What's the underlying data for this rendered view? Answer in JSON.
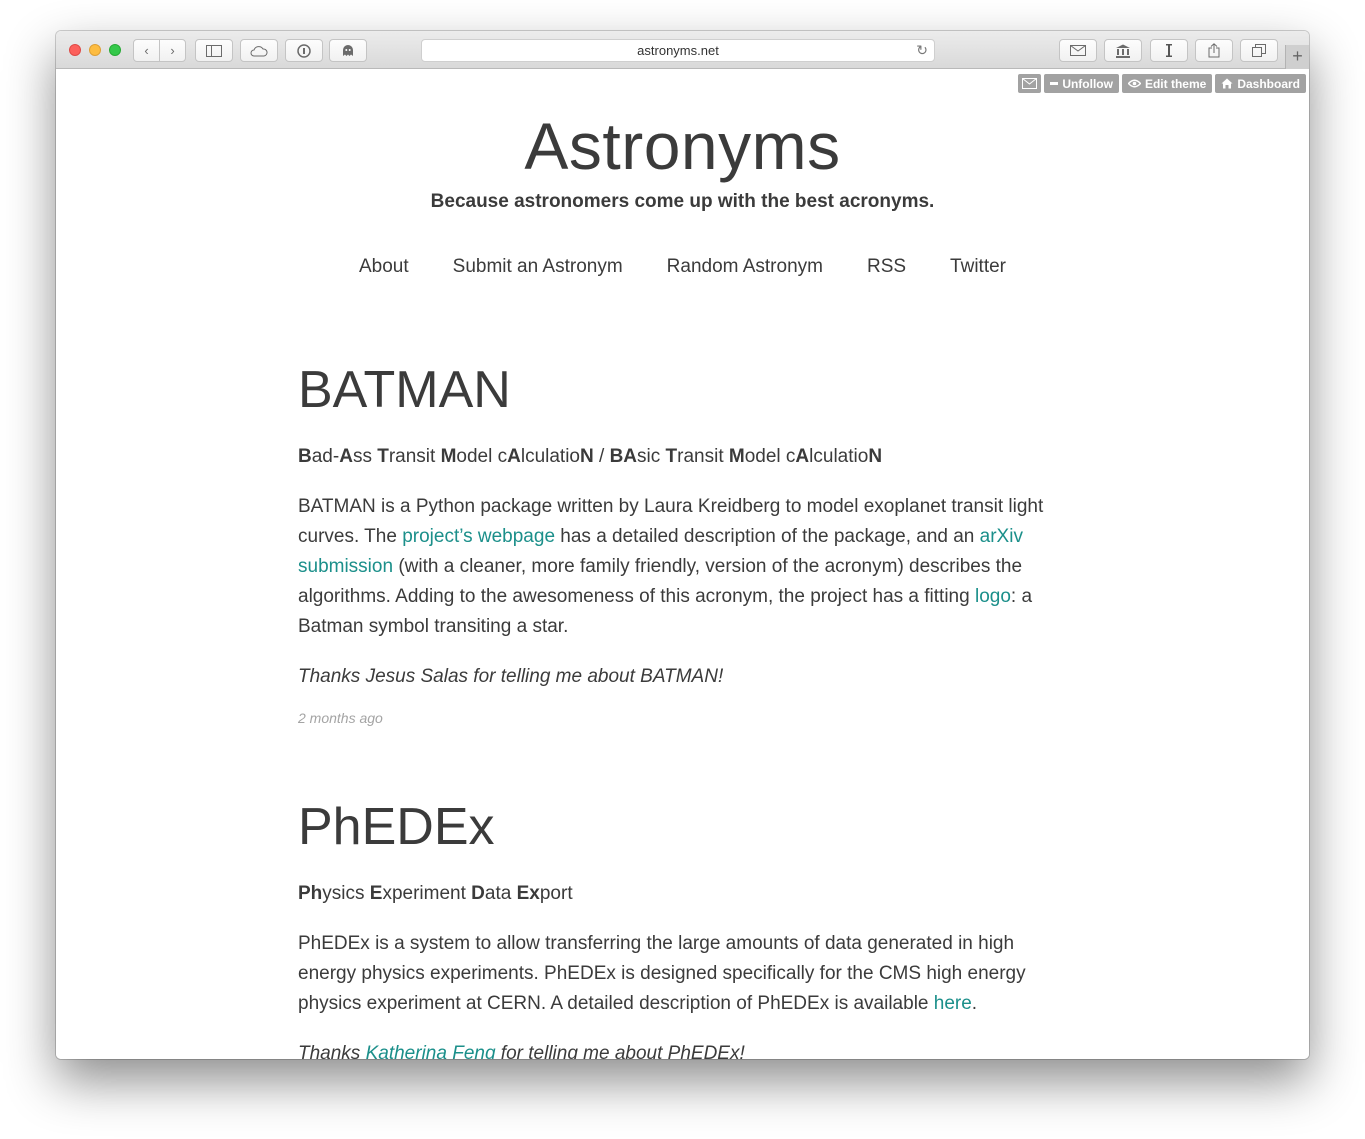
{
  "browser": {
    "url": "astronyms.net",
    "nav_back": "‹",
    "nav_forward": "›",
    "new_tab": "+",
    "reload": "↻"
  },
  "tumblr": {
    "unfollow": "Unfollow",
    "edit_theme": "Edit theme",
    "dashboard": "Dashboard"
  },
  "site": {
    "title": "Astronyms",
    "description": "Because astronomers come up with the best acronyms.",
    "nav": [
      "About",
      "Submit an Astronym",
      "Random Astronym",
      "RSS",
      "Twitter"
    ]
  },
  "posts": [
    {
      "title": "BATMAN",
      "expansion_1": {
        "b1": "B",
        "t1": "ad-",
        "b2": "A",
        "t2": "ss ",
        "b3": "T",
        "t3": "ransit ",
        "b4": "M",
        "t4": "odel c",
        "b5": "A",
        "t5": "lculatio",
        "b6": "N"
      },
      "expansion_sep": " / ",
      "expansion_2": {
        "b1": "BA",
        "t1": "sic ",
        "b2": "T",
        "t2": "ransit ",
        "b3": "M",
        "t3": "odel c",
        "b4": "A",
        "t4": "lculatio",
        "b5": "N"
      },
      "body": {
        "p1": "BATMAN is a Python package written by Laura Kreidberg to model exoplanet transit light curves. The ",
        "link1": "project’s webpage",
        "p2": " has a detailed description of the package, and an ",
        "link2": "arXiv submission",
        "p3": " (with a cleaner, more family friendly, version of the acronym) describes the algorithms. Adding to the awesomeness of this acronym, the project has a fitting ",
        "link3": "logo",
        "p4": ": a Batman symbol transiting a star."
      },
      "thanks": "Thanks Jesus Salas for telling me about BATMAN!",
      "time": "2 months ago"
    },
    {
      "title": "PhEDEx",
      "expansion": {
        "b1": "Ph",
        "t1": "ysics ",
        "b2": "E",
        "t2": "xperiment ",
        "b3": "D",
        "t3": "ata ",
        "b4": "Ex",
        "t4": "port"
      },
      "body": {
        "p1": "PhEDEx is a system to allow transferring the large amounts of data generated in high energy physics experiments. PhEDEx is designed specifically for the CMS high energy physics experiment at CERN. A detailed description of PhEDEx is available ",
        "link1": "here",
        "p2": "."
      },
      "thanks_pre": "Thanks ",
      "thanks_link": "Katherina Feng",
      "thanks_post": " for telling me about PhEDEx!"
    }
  ]
}
